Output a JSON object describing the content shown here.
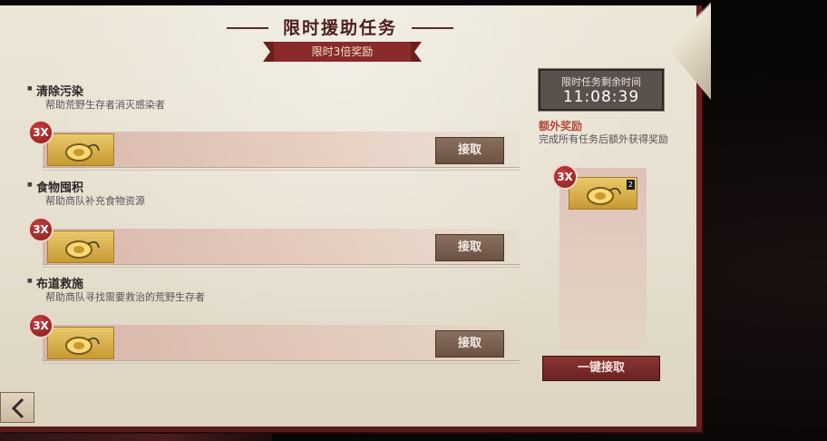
{
  "header": {
    "title": "限时援助任务",
    "ribbon_text": "限时3倍奖励"
  },
  "tasks": [
    {
      "title": "清除污染",
      "description": "帮助荒野生存者消灭感染者",
      "multiplier": "3X",
      "reward_icon": "gold-tag-icon",
      "button_label": "接取"
    },
    {
      "title": "食物囤积",
      "description": "帮助商队补充食物资源",
      "multiplier": "3X",
      "reward_icon": "gold-tag-icon",
      "button_label": "接取"
    },
    {
      "title": "布道救施",
      "description": "帮助商队寻找需要救治的荒野生存者",
      "multiplier": "3X",
      "reward_icon": "gold-tag-icon",
      "button_label": "接取"
    }
  ],
  "timer": {
    "label": "限时任务剩余时间",
    "value": "11:08:39"
  },
  "extra_reward": {
    "title": "额外奖励",
    "description": "完成所有任务后额外获得奖励",
    "multiplier": "3X",
    "item_count": "2",
    "reward_icon": "gold-tag-icon",
    "button_label": "一键接取"
  },
  "colors": {
    "accent_red": "#8a2a2a",
    "parchment": "#e6dfcf",
    "gold": "#d9b04c"
  }
}
